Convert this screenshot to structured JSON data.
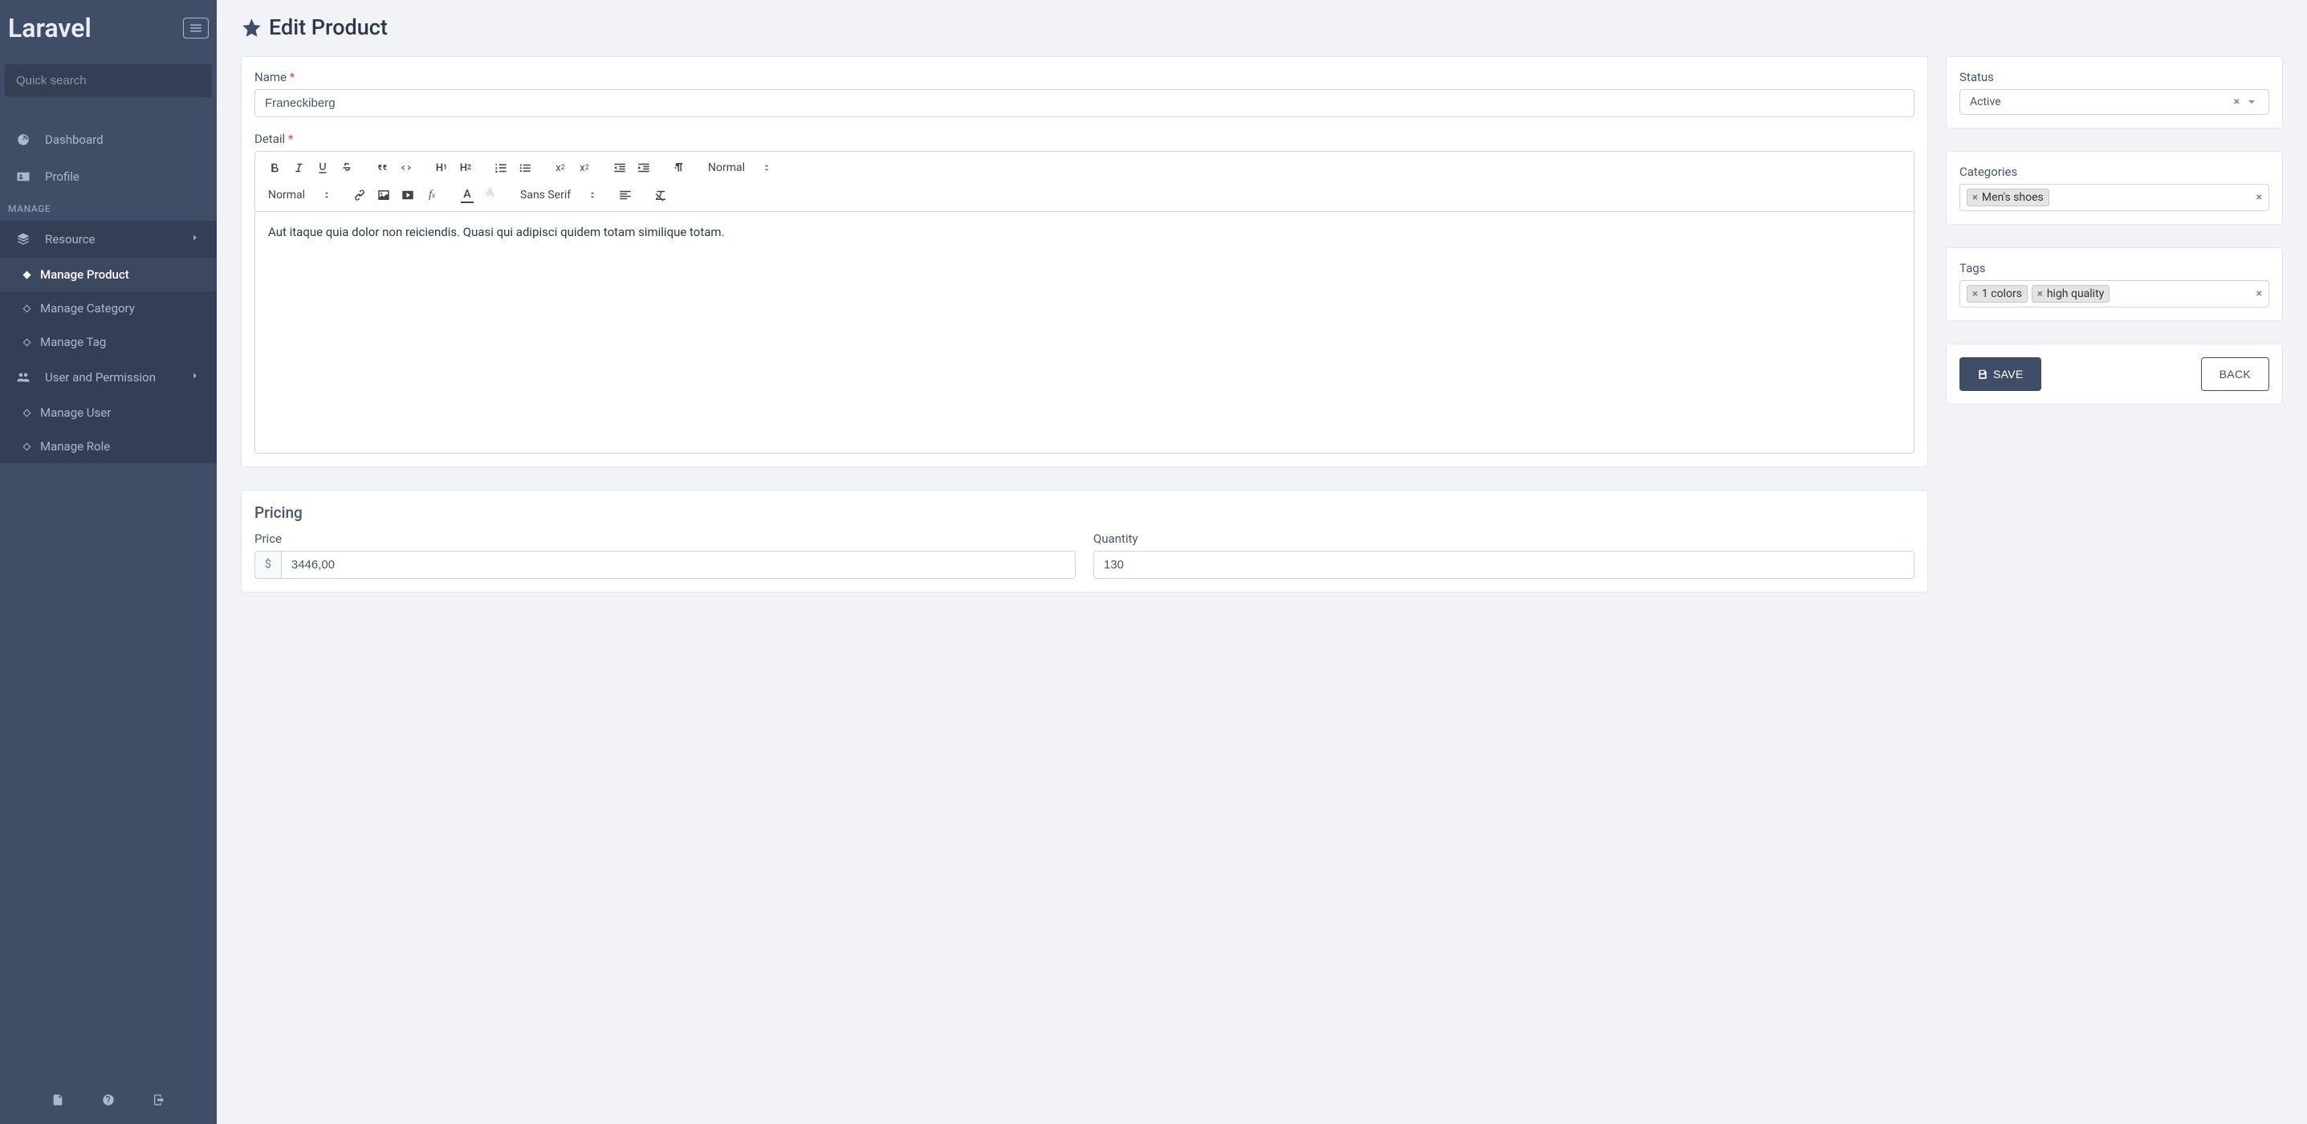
{
  "brand": "Laravel",
  "search": {
    "placeholder": "Quick search"
  },
  "nav": {
    "dashboard": "Dashboard",
    "profile": "Profile",
    "group_label": "MANAGE",
    "resource": "Resource",
    "manage_product": "Manage Product",
    "manage_category": "Manage Category",
    "manage_tag": "Manage Tag",
    "user_permission": "User and Permission",
    "manage_user": "Manage User",
    "manage_role": "Manage Role"
  },
  "page_title": "Edit Product",
  "form": {
    "name_label": "Name",
    "name_value": "Franeckiberg",
    "detail_label": "Detail",
    "detail_body": "Aut itaque quia dolor non reiciendis. Quasi qui adipisci quidem totam similique totam.",
    "toolbar": {
      "header_sel": "Normal",
      "size_sel": "Normal",
      "font_sel": "Sans Serif"
    },
    "pricing_title": "Pricing",
    "price_label": "Price",
    "price_currency": "$",
    "price_value": "3446,00",
    "quantity_label": "Quantity",
    "quantity_value": "130"
  },
  "side": {
    "status_label": "Status",
    "status_value": "Active",
    "categories_label": "Categories",
    "categories": [
      "Men's shoes"
    ],
    "tags_label": "Tags",
    "tags": [
      "1 colors",
      "high quality"
    ]
  },
  "actions": {
    "save": "SAVE",
    "back": "BACK"
  }
}
